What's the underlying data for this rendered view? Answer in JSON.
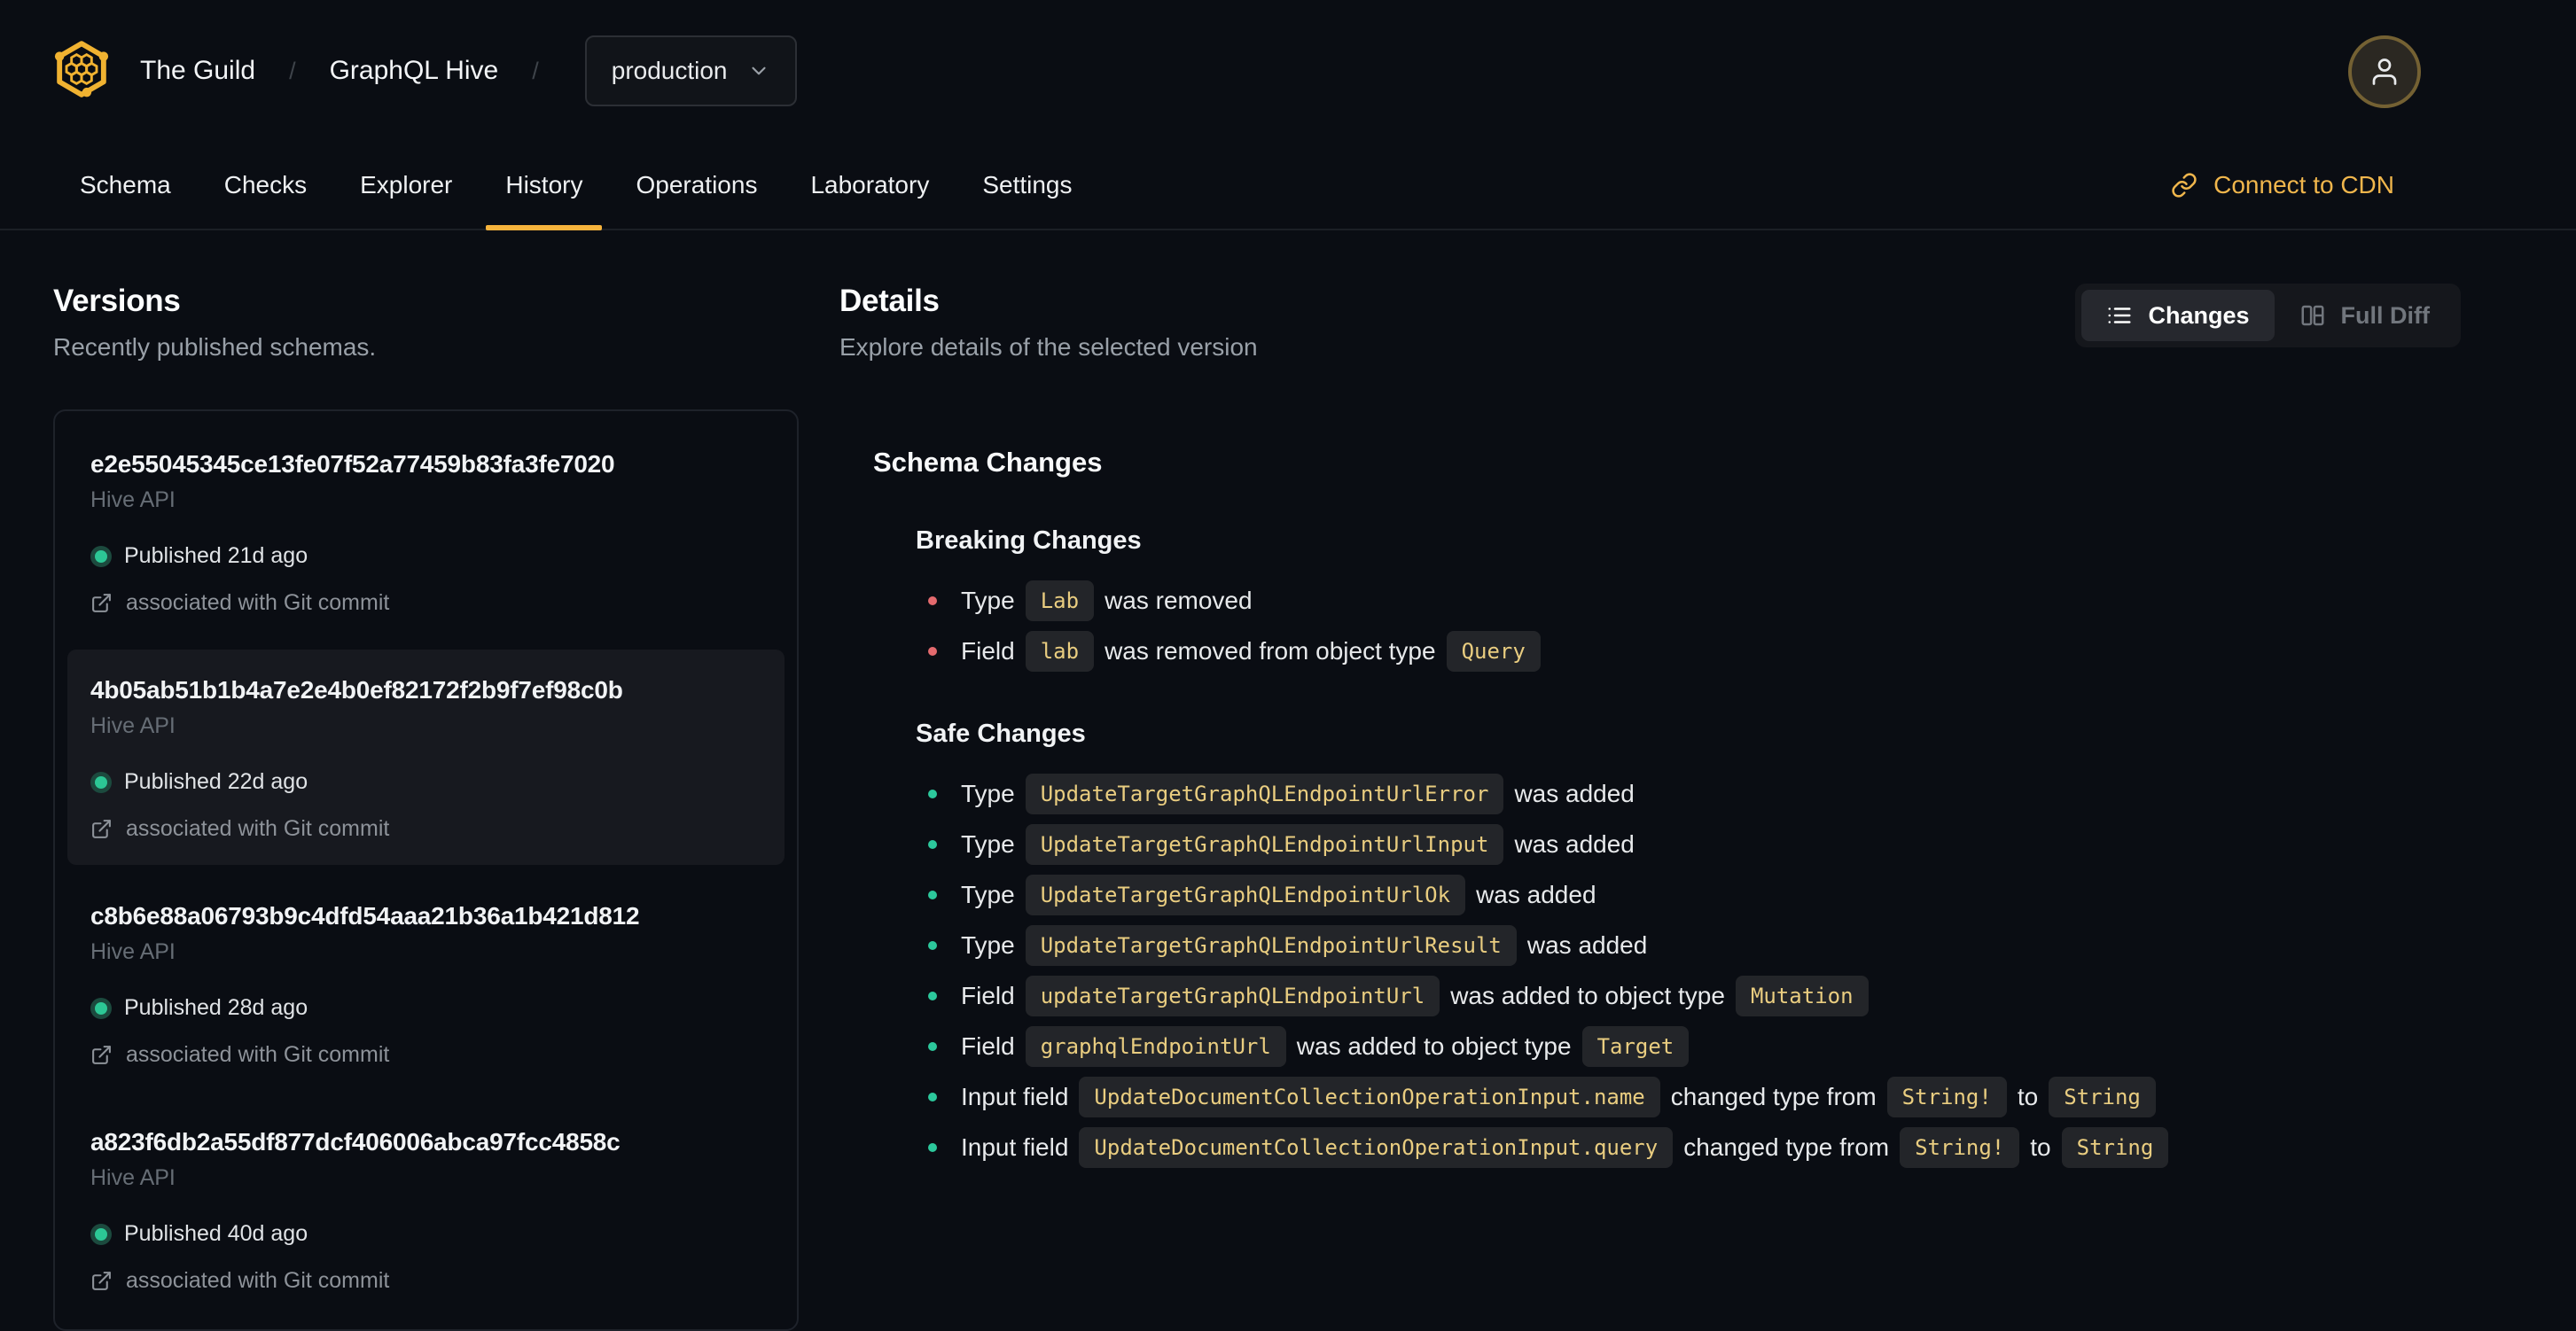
{
  "header": {
    "org_name": "The Guild",
    "project_name": "GraphQL Hive",
    "separator": "/",
    "environment": "production"
  },
  "nav": {
    "tabs": [
      "Schema",
      "Checks",
      "Explorer",
      "History",
      "Operations",
      "Laboratory",
      "Settings"
    ],
    "active_tab": "History",
    "connect_cdn_label": "Connect to CDN"
  },
  "versions_panel": {
    "title": "Versions",
    "subtitle": "Recently published schemas.",
    "items": [
      {
        "hash": "e2e55045345ce13fe07f52a77459b83fa3fe7020",
        "service": "Hive API",
        "published": "Published 21d ago",
        "commit_link": "associated with Git commit",
        "selected": false
      },
      {
        "hash": "4b05ab51b1b4a7e2e4b0ef82172f2b9f7ef98c0b",
        "service": "Hive API",
        "published": "Published 22d ago",
        "commit_link": "associated with Git commit",
        "selected": true
      },
      {
        "hash": "c8b6e88a06793b9c4dfd54aaa21b36a1b421d812",
        "service": "Hive API",
        "published": "Published 28d ago",
        "commit_link": "associated with Git commit",
        "selected": false
      },
      {
        "hash": "a823f6db2a55df877dcf406006abca97fcc4858c",
        "service": "Hive API",
        "published": "Published 40d ago",
        "commit_link": "associated with Git commit",
        "selected": false
      }
    ]
  },
  "details_panel": {
    "title": "Details",
    "subtitle": "Explore details of the selected version",
    "view_toggle": {
      "options": [
        {
          "label": "Changes",
          "icon": "list-icon",
          "active": true
        },
        {
          "label": "Full Diff",
          "icon": "columns-icon",
          "active": false
        }
      ]
    },
    "schema_changes": {
      "title": "Schema Changes",
      "groups": [
        {
          "title": "Breaking Changes",
          "severity": "breaking",
          "items": [
            [
              {
                "text": "Type"
              },
              {
                "code": "Lab"
              },
              {
                "text": "was removed"
              }
            ],
            [
              {
                "text": "Field"
              },
              {
                "code": "lab"
              },
              {
                "text": "was removed from object type"
              },
              {
                "code": "Query"
              }
            ]
          ]
        },
        {
          "title": "Safe Changes",
          "severity": "safe",
          "items": [
            [
              {
                "text": "Type"
              },
              {
                "code": "UpdateTargetGraphQLEndpointUrlError"
              },
              {
                "text": "was added"
              }
            ],
            [
              {
                "text": "Type"
              },
              {
                "code": "UpdateTargetGraphQLEndpointUrlInput"
              },
              {
                "text": "was added"
              }
            ],
            [
              {
                "text": "Type"
              },
              {
                "code": "UpdateTargetGraphQLEndpointUrlOk"
              },
              {
                "text": "was added"
              }
            ],
            [
              {
                "text": "Type"
              },
              {
                "code": "UpdateTargetGraphQLEndpointUrlResult"
              },
              {
                "text": "was added"
              }
            ],
            [
              {
                "text": "Field"
              },
              {
                "code": "updateTargetGraphQLEndpointUrl"
              },
              {
                "text": "was added to object type"
              },
              {
                "code": "Mutation"
              }
            ],
            [
              {
                "text": "Field"
              },
              {
                "code": "graphqlEndpointUrl"
              },
              {
                "text": "was added to object type"
              },
              {
                "code": "Target"
              }
            ],
            [
              {
                "text": "Input field"
              },
              {
                "code": "UpdateDocumentCollectionOperationInput.name"
              },
              {
                "text": "changed type from"
              },
              {
                "code": "String!"
              },
              {
                "text": "to"
              },
              {
                "code": "String"
              }
            ],
            [
              {
                "text": "Input field"
              },
              {
                "code": "UpdateDocumentCollectionOperationInput.query"
              },
              {
                "text": "changed type from"
              },
              {
                "code": "String!"
              },
              {
                "text": "to"
              },
              {
                "code": "String"
              }
            ]
          ]
        }
      ]
    }
  },
  "icons": {
    "logo": "hive-hexagon-logo",
    "environment_dropdown": "chevron-down-icon",
    "avatar": "person-icon",
    "connect_cdn": "link-icon",
    "git_commit": "external-link-icon",
    "changes_view": "list-icon",
    "full_diff_view": "columns-icon",
    "published_status": "green-dot"
  },
  "colors": {
    "background": "#0a0d13",
    "accent_yellow": "#f6b33c",
    "cdn_link": "#f0b64c",
    "code_text": "#e9cd80",
    "code_background": "#232529",
    "breaking_bullet": "#e46a6e",
    "safe_bullet": "#2cc89c",
    "published_dot": "#2cc795",
    "selected_card_background": "#17191f"
  }
}
